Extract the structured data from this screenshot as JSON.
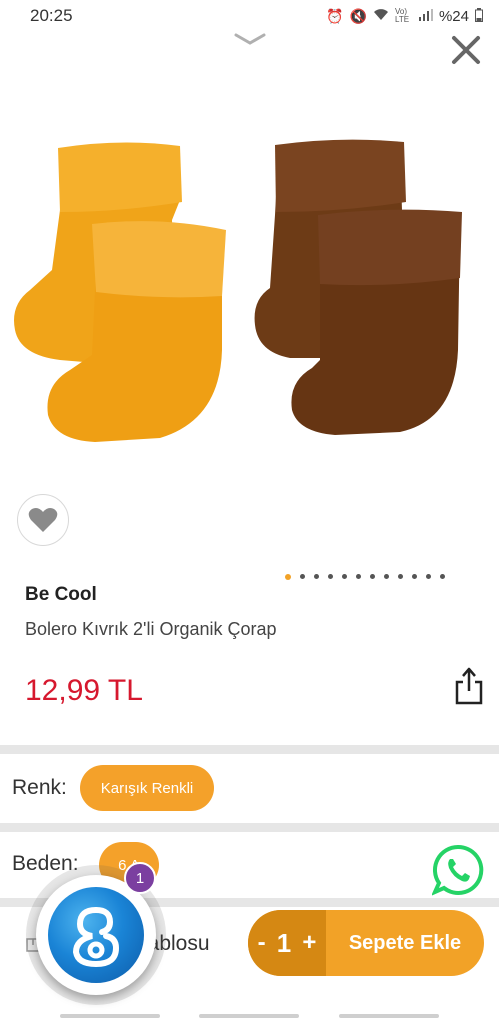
{
  "status_bar": {
    "time": "20:25",
    "volte": "Vo) LTE",
    "battery": "%24"
  },
  "product": {
    "brand": "Be Cool",
    "name": "Bolero Kıvrık 2'li Organik Çorap",
    "price": "12,99 TL",
    "image_page": 1,
    "image_count": 12
  },
  "options": {
    "color_label": "Renk:",
    "color_value": "Karışık Renkli",
    "size_label": "Beden:",
    "size_value": "6 A",
    "size_chart_label": "n Tablosu"
  },
  "cart": {
    "minus": "-",
    "quantity": "1",
    "plus": "+",
    "add_label": "Sepete Ekle"
  },
  "chat_badge": "1",
  "colors": {
    "accent": "#f2a227",
    "accent_dark": "#d58813",
    "price": "#d6182e",
    "whatsapp": "#25d366"
  }
}
